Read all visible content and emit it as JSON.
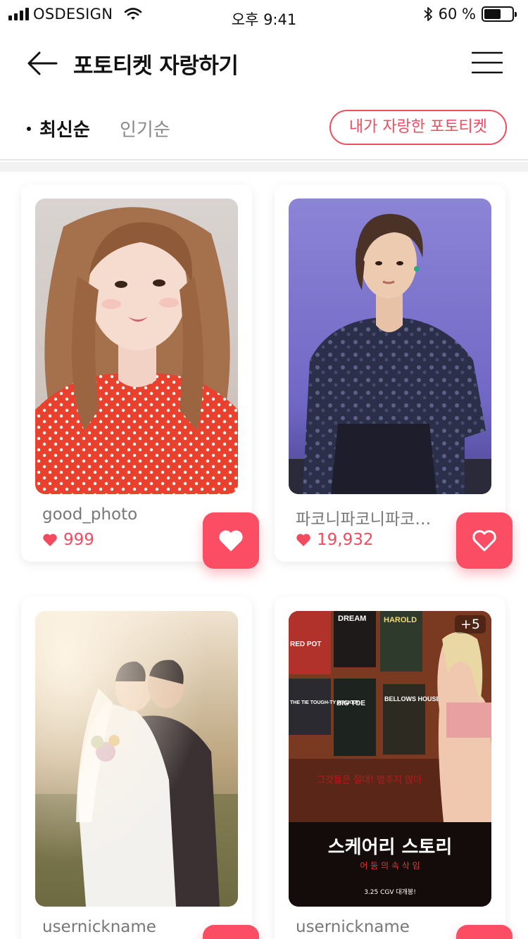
{
  "status_bar": {
    "carrier": "OSDESIGN",
    "time": "오후 9:41",
    "battery_percent": "60 %",
    "battery_level": 0.6
  },
  "header": {
    "title": "포토티켓 자랑하기",
    "back_icon": "arrow-left-icon",
    "menu_icon": "hamburger-menu-icon"
  },
  "sort_tabs": [
    {
      "label": "최신순",
      "active": true
    },
    {
      "label": "인기순",
      "active": false
    }
  ],
  "my_tickets_button": "내가 자랑한 포토티켓",
  "colors": {
    "accent": "#fb4d63",
    "accent_text": "#f24b60"
  },
  "cards": [
    {
      "nickname": "good_photo",
      "likes": "999",
      "liked": true,
      "image": "woman-red-polka-dot-photo",
      "extra_count": ""
    },
    {
      "nickname": "파코니파코니파코니파코니",
      "likes": "19,932",
      "liked": false,
      "image": "man-stage-floral-shirt-photo",
      "extra_count": ""
    },
    {
      "nickname": "usernickname",
      "likes": "",
      "liked": false,
      "image": "wedding-couple-photo",
      "extra_count": ""
    },
    {
      "nickname": "usernickname",
      "likes": "",
      "liked": false,
      "image": "scary-stories-movie-poster",
      "extra_count": "+5"
    }
  ],
  "poster_text": {
    "title": "스케어리 스토리",
    "subtitle": "어 둠 의 속 삭 임",
    "tagline": "그것들은 절대! 멈추지 않아",
    "release": "3.25 CGV 대개봉!",
    "wall_posters": [
      "DREAM",
      "HAROLD",
      "RED POT",
      "THE TIE TOUGH-TY WALKER",
      "BIG TOE",
      "BELLOWS HOUSE"
    ]
  }
}
